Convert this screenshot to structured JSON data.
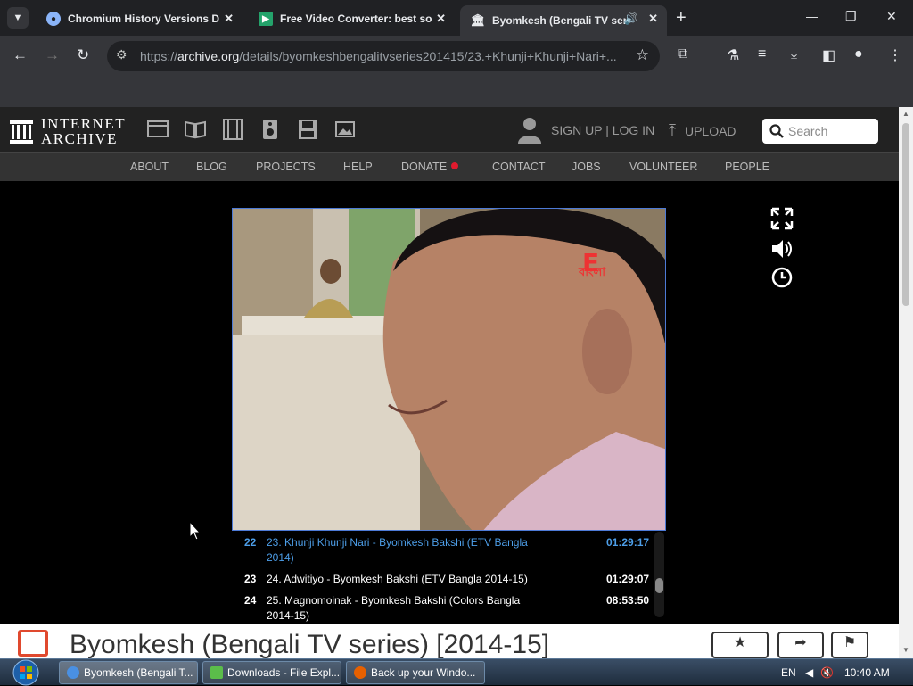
{
  "browser": {
    "tabs": [
      {
        "title": "Chromium History Versions Do",
        "icon": "chromium-icon"
      },
      {
        "title": "Free Video Converter: best soft",
        "icon": "video-converter-icon"
      },
      {
        "title": "Byomkesh (Bengali TV serie",
        "icon": "internet-archive-icon",
        "active": true,
        "audio": true
      }
    ],
    "url_host": "archive.org",
    "url_prefix": "https://",
    "url_path": "/details/byomkeshbengalitvseries201415/23.+Khunji+Khunji+Nari+..."
  },
  "site": {
    "logo_line1": "INTERNET",
    "logo_line2": "ARCHIVE",
    "user_link": "SIGN UP | LOG IN",
    "upload_label": "UPLOAD",
    "search_placeholder": "Search",
    "nav": [
      "ABOUT",
      "BLOG",
      "PROJECTS",
      "HELP",
      "DONATE",
      "CONTACT",
      "JOBS",
      "VOLUNTEER",
      "PEOPLE"
    ],
    "accent": "#4d9ee8"
  },
  "video": {
    "channel_logo_text": "বাংলা"
  },
  "playlist": [
    {
      "num": "22",
      "title": "23. Khunji Khunji Nari - Byomkesh Bakshi (ETV Bangla 2014)",
      "duration": "01:29:17",
      "current": true
    },
    {
      "num": "23",
      "title": "24. Adwitiyo - Byomkesh Bakshi (ETV Bangla 2014-15)",
      "duration": "01:29:07"
    },
    {
      "num": "24",
      "title": "25. Magnomoinak - Byomkesh Bakshi (Colors Bangla 2014-15)",
      "duration": "08:53:50"
    }
  ],
  "item_title": "Byomkesh (Bengali TV series) [2014-15]",
  "taskbar": {
    "buttons": [
      {
        "label": "Byomkesh (Bengali T...",
        "icon": "chrome-icon"
      },
      {
        "label": "Downloads - File Expl...",
        "icon": "download-folder-icon"
      },
      {
        "label": "Back up your Windo...",
        "icon": "firefox-icon"
      }
    ],
    "lang": "EN",
    "clock": "10:40 AM"
  }
}
